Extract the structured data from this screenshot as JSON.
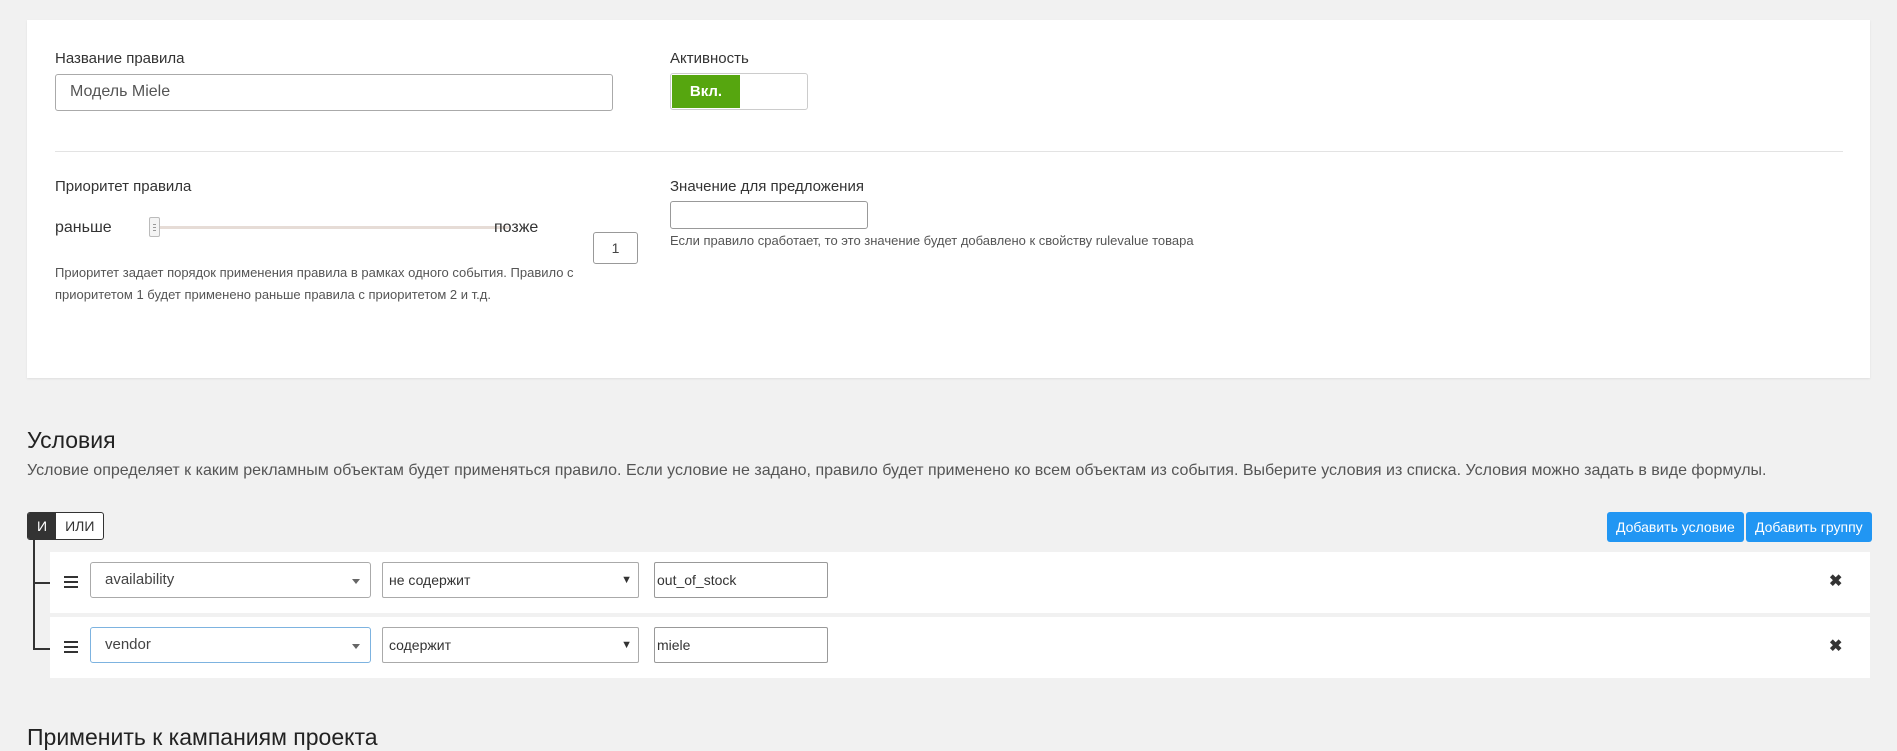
{
  "rule": {
    "name_label": "Название правила",
    "name_value": "Модель Miele",
    "activity_label": "Активность",
    "activity_on_label": "Вкл."
  },
  "priority": {
    "label": "Приоритет правила",
    "earlier_label": "раньше",
    "later_label": "позже",
    "value": "1",
    "help_line1": "Приоритет задает порядок применения правила в рамках одного события. Правило с",
    "help_line2": "приоритетом 1 будет применено раньше правила с приоритетом 2 и т.д."
  },
  "offer_value": {
    "label": "Значение для предложения",
    "value": "",
    "help": "Если правило сработает, то это значение будет добавлено к свойству rulevalue товара"
  },
  "conditions": {
    "title": "Условия",
    "description": "Условие определяет к каким рекламным объектам будет применяться правило. Если условие не задано, правило будет применено ко всем объектам из события. Выберите условия из списка. Условия можно задать в виде формулы.",
    "and_label": "И",
    "or_label": "ИЛИ",
    "add_condition_label": "Добавить условие",
    "add_group_label": "Добавить группу",
    "rows": [
      {
        "field": "availability",
        "operator": "не содержит",
        "value": "out_of_stock"
      },
      {
        "field": "vendor",
        "operator": "содержит",
        "value": "miele"
      }
    ]
  },
  "next_section_title": "Применить к кампаниям проекта"
}
